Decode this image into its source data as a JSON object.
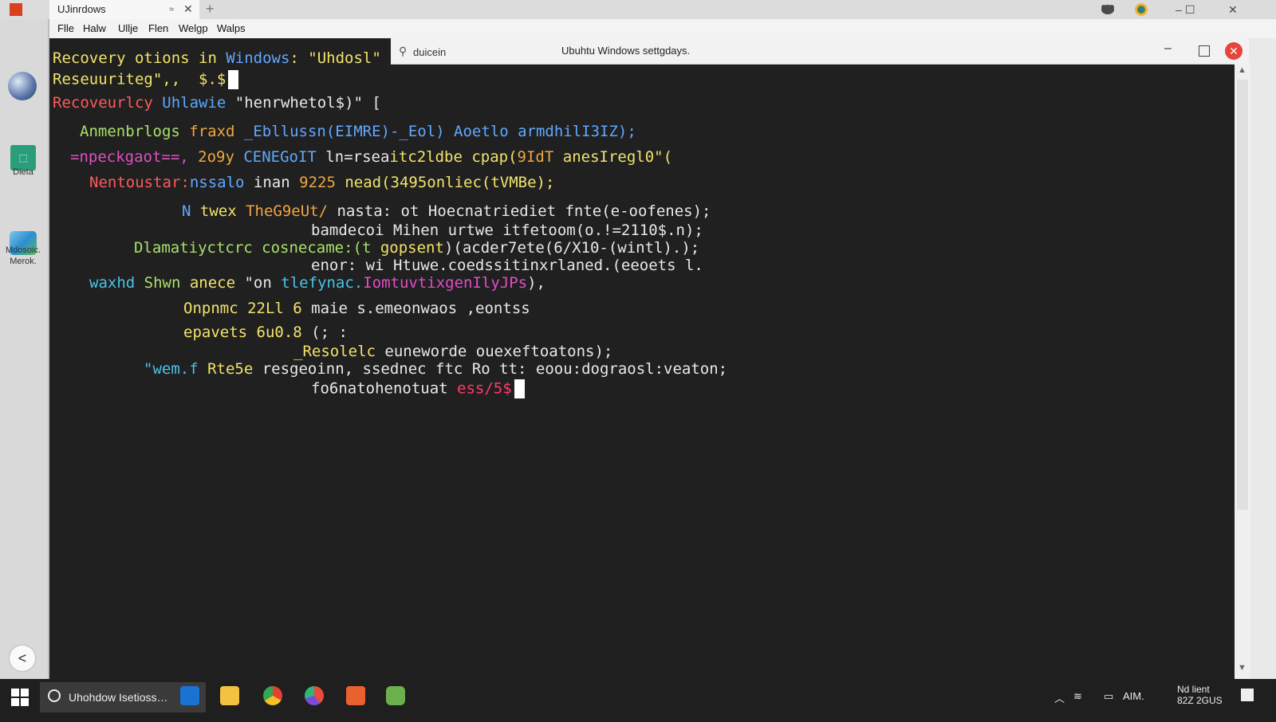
{
  "app": {
    "tab_title": "UJinrdows",
    "tab_marker": "≈",
    "close_symbol": "✕",
    "new_tab_symbol": "+",
    "window_min": "–",
    "window_max": "☐",
    "window_close": "✕"
  },
  "menu": [
    "Flle",
    "Halw",
    "Ullje",
    "Flen",
    "Welgp",
    "Walps"
  ],
  "sidebar": {
    "item2_label": "Dieta",
    "item3_label_line1": "Mdosoic.",
    "item3_label_line2": "Merok.",
    "back_symbol": "<"
  },
  "overlay": {
    "search_text": "duicein",
    "title": "Ubuhtu Windows settgdays."
  },
  "terminal": {
    "lines": [
      {
        "segs": [
          {
            "t": "Recovery otions in ",
            "c": "y"
          },
          {
            "t": "Windows",
            "c": "b"
          },
          {
            "t": ": \"Uhdosl\"",
            "c": "y"
          }
        ]
      },
      {
        "segs": [
          {
            "t": "Reseuuriteg\",,  $.$",
            "c": "y"
          }
        ],
        "cursor": true
      },
      {
        "segs": [
          {
            "t": "Recoveurlcy ",
            "c": "r"
          },
          {
            "t": "Uhlawie ",
            "c": "b"
          },
          {
            "t": "\"henrwhetol$)\" [",
            "c": "w"
          }
        ]
      },
      {
        "segs": [
          {
            "t": "Anmenbrlogs ",
            "c": "g"
          },
          {
            "t": "fraxd ",
            "c": "o"
          },
          {
            "t": "_Ebllussn(EIMRE)-_Eol) ",
            "c": "b"
          },
          {
            "t": "Aoetlo armdhilI3IZ);",
            "c": "b"
          }
        ]
      },
      {
        "segs": [
          {
            "t": "=npeckgaot==, ",
            "c": "m"
          },
          {
            "t": "2o9y ",
            "c": "o"
          },
          {
            "t": "CENEGoIT ",
            "c": "b"
          },
          {
            "t": "ln=rsea",
            "c": "w"
          },
          {
            "t": "itc2ldbe cpap(",
            "c": "y"
          },
          {
            "t": "9IdT ",
            "c": "o"
          },
          {
            "t": "anesIregl0\"(",
            "c": "y"
          }
        ]
      },
      {
        "segs": [
          {
            "t": "Nentoustar:",
            "c": "r"
          },
          {
            "t": "nssalo ",
            "c": "b"
          },
          {
            "t": "inan ",
            "c": "w"
          },
          {
            "t": "9225 ",
            "c": "o"
          },
          {
            "t": "nead(3495onliec(tVMBe);",
            "c": "y"
          }
        ]
      },
      {
        "segs": [
          {
            "t": "N ",
            "c": "b"
          },
          {
            "t": "twex ",
            "c": "y"
          },
          {
            "t": "TheG9eUt/ ",
            "c": "o"
          },
          {
            "t": "nasta: ot Hoecnatriediet fnte(e-oofenes);",
            "c": "w"
          }
        ]
      },
      {
        "segs": [
          {
            "t": "bamdecoi Mihen urtwe itfetoom(o.!=2110$.n);",
            "c": "w"
          }
        ]
      },
      {
        "segs": [
          {
            "t": "Dlamatiyctcrc cosnecame:(t ",
            "c": "g"
          },
          {
            "t": "gopsent",
            "c": "y"
          },
          {
            "t": ")(acder7ete(6/X10-(wintl).);",
            "c": "w"
          }
        ]
      },
      {
        "segs": [
          {
            "t": "enor: wi Htuwe.coedssitinxrlaned.(eeoets l.",
            "c": "w"
          }
        ]
      },
      {
        "segs": [
          {
            "t": "waxhd ",
            "c": "c"
          },
          {
            "t": "Shwn ",
            "c": "g"
          },
          {
            "t": "anece ",
            "c": "y"
          },
          {
            "t": "\"on ",
            "c": "w"
          },
          {
            "t": "tlefynac.",
            "c": "c"
          },
          {
            "t": "IomtuvtixgenIlyJPs",
            "c": "m"
          },
          {
            "t": "),",
            "c": "w"
          }
        ]
      },
      {
        "segs": [
          {
            "t": "Onpnmc 22Ll 6 ",
            "c": "y"
          },
          {
            "t": "maie s.emeonwaos ,eontss",
            "c": "w"
          }
        ]
      },
      {
        "segs": [
          {
            "t": "epavets 6u0.8 ",
            "c": "y"
          },
          {
            "t": "(; :",
            "c": "w"
          }
        ]
      },
      {
        "segs": [
          {
            "t": "_Resolelc ",
            "c": "y"
          },
          {
            "t": "euneworde ouexeftoatons);",
            "c": "w"
          }
        ]
      },
      {
        "segs": [
          {
            "t": "\"wem.f ",
            "c": "c"
          },
          {
            "t": "Rte5e ",
            "c": "y"
          },
          {
            "t": "resgeoinn, ssednec ftc Ro tt: eoou:dograosl:veaton;",
            "c": "w"
          }
        ]
      },
      {
        "segs": [
          {
            "t": "fo6natohenotuat ",
            "c": "w"
          },
          {
            "t": "ess/5$",
            "c": "pk"
          }
        ],
        "cursor": true
      }
    ]
  },
  "taskbar": {
    "search_text": "Uhohdow Isetioss…",
    "tray_text": "AIM.",
    "clock_line1": "Nd lient",
    "clock_line2": "82Z 2GUS"
  },
  "colors": {
    "terminal_bg": "#202020",
    "taskbar_bg": "#1f1f1f",
    "close_red": "#e5453a"
  }
}
